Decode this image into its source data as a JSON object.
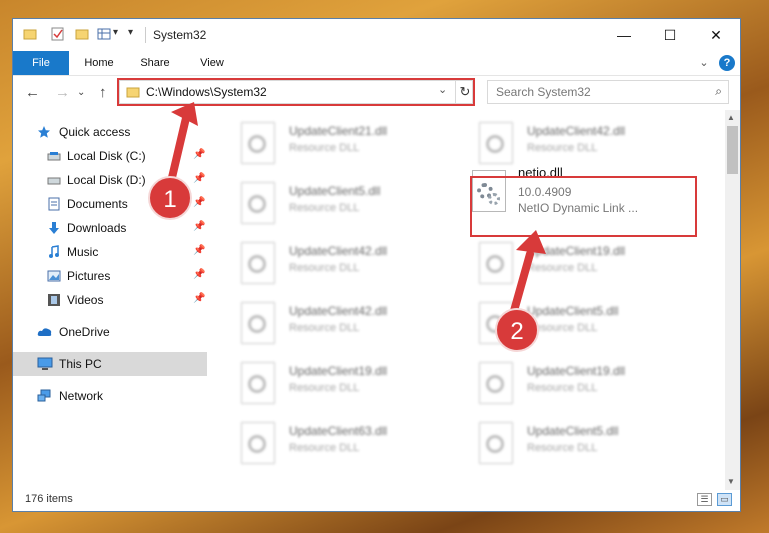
{
  "window": {
    "title": "System32",
    "minimize": "—",
    "maximize": "☐",
    "close": "✕"
  },
  "quick_access_toolbar": {
    "dropdown": "▾"
  },
  "ribbon": {
    "tabs": [
      "File",
      "Home",
      "Share",
      "View"
    ],
    "expand": "⌄",
    "help": "?"
  },
  "nav": {
    "back": "←",
    "forward": "→",
    "recent": "⌄",
    "up": "↑",
    "address": "C:\\Windows\\System32",
    "address_dropdown": "⌄",
    "refresh": "↻",
    "search_placeholder": "Search System32",
    "search_icon": "⌕"
  },
  "sidebar": {
    "items": [
      {
        "label": "Quick access",
        "icon": "star-icon",
        "pinned": false
      },
      {
        "label": "Local Disk (C:)",
        "icon": "drive-icon",
        "pinned": true
      },
      {
        "label": "Local Disk (D:)",
        "icon": "drive-icon",
        "pinned": true
      },
      {
        "label": "Documents",
        "icon": "documents-icon",
        "pinned": true
      },
      {
        "label": "Downloads",
        "icon": "download-icon",
        "pinned": true
      },
      {
        "label": "Music",
        "icon": "music-icon",
        "pinned": true
      },
      {
        "label": "Pictures",
        "icon": "pictures-icon",
        "pinned": true
      },
      {
        "label": "Videos",
        "icon": "videos-icon",
        "pinned": true
      },
      {
        "label": "OneDrive",
        "icon": "cloud-icon",
        "pinned": false
      },
      {
        "label": "This PC",
        "icon": "computer-icon",
        "pinned": false,
        "selected": true
      },
      {
        "label": "Network",
        "icon": "network-icon",
        "pinned": false
      }
    ],
    "pin_glyph": "📌"
  },
  "files": [
    {
      "name": "UpdateClient21.dll",
      "desc": "Resource DLL"
    },
    {
      "name": "UpdateClient42.dll",
      "desc": "Resource DLL"
    },
    {
      "name": "UpdateClient5.dll",
      "desc": "Resource DLL"
    },
    {
      "name": "UpdateClient42.dll",
      "desc": "Resource DLL"
    },
    {
      "name": "UpdateClient19.dll",
      "desc": "Resource DLL"
    },
    {
      "name": "UpdateClient42.dll",
      "desc": "Resource DLL"
    },
    {
      "name": "UpdateClient5.dll",
      "desc": "Resource DLL"
    },
    {
      "name": "UpdateClient19.dll",
      "desc": "Resource DLL"
    },
    {
      "name": "UpdateClient19.dll",
      "desc": "Resource DLL"
    },
    {
      "name": "UpdateClient63.dll",
      "desc": "Resource DLL"
    },
    {
      "name": "UpdateClient5.dll",
      "desc": "Resource DLL"
    }
  ],
  "highlighted_file": {
    "name": "netio.dll",
    "version": "10.0.4909",
    "description": "NetIO Dynamic Link ..."
  },
  "status": {
    "item_count": "176 items",
    "details_view": "☰",
    "large_icons_view": "▭"
  },
  "scrollbar": {
    "up": "▲",
    "down": "▼"
  },
  "annotations": {
    "step1": "1",
    "step2": "2",
    "color": "#d83a3a"
  },
  "colors": {
    "file_tab": "#1979ca",
    "selected_item": "#d9d9d9",
    "annotation": "#d83a3a"
  }
}
